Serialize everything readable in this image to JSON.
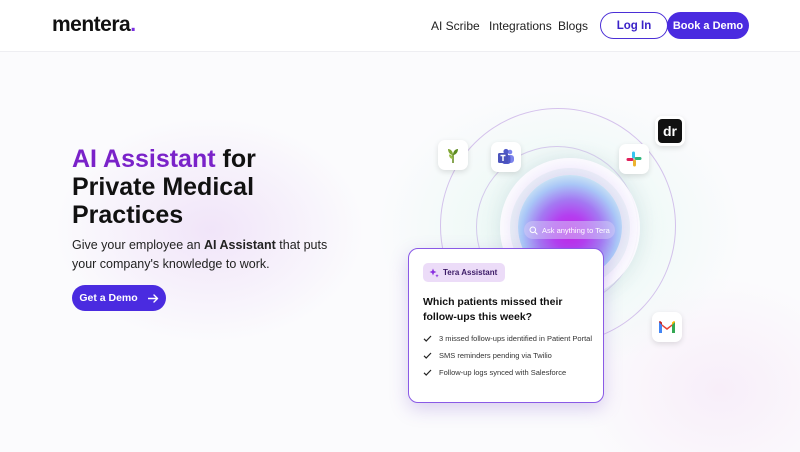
{
  "header": {
    "logo": "mentera",
    "logo_dot": ".",
    "nav": [
      "AI Scribe",
      "Integrations",
      "Blogs"
    ],
    "login_label": "Log In",
    "demo_label": "Book a Demo"
  },
  "hero": {
    "title_accent": "AI Assistant",
    "title_rest_1": " for",
    "title_line2": "Private Medical",
    "title_line3": "Practices",
    "sub_before": "Give your employee an ",
    "sub_bold": "AI Assistant",
    "sub_after": " that puts your company's knowledge to work.",
    "cta_label": "Get a Demo",
    "cta_icon": "arrow-right-icon"
  },
  "orb": {
    "search_placeholder": "Ask anything to Tera"
  },
  "app_icons": [
    "sprout-icon",
    "teams-icon",
    "slack-icon",
    "dr-icon",
    "gmail-icon"
  ],
  "dr_label": "dr",
  "card": {
    "badge": "Tera Assistant",
    "question": "Which patients missed their follow-ups this week?",
    "items": [
      "3 missed follow-ups identified in Patient Portal",
      "SMS reminders pending via Twilio",
      "Follow-up logs synced with Salesforce"
    ]
  },
  "colors": {
    "brand": "#4a2be0",
    "accent": "#7a22c9"
  }
}
